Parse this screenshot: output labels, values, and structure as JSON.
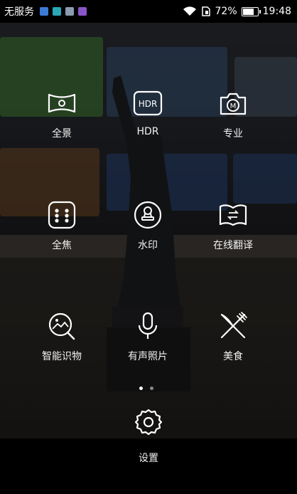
{
  "status_bar": {
    "carrier": "无服务",
    "battery_percent": "72%",
    "time": "19:48",
    "notification_icons": [
      "blue-app-icon",
      "teal-app-icon",
      "gallery-icon",
      "purple-app-icon"
    ]
  },
  "modes": [
    {
      "label": "全景",
      "icon": "panorama-icon"
    },
    {
      "label": "HDR",
      "icon": "hdr-icon",
      "icon_text": "HDR"
    },
    {
      "label": "专业",
      "icon": "pro-mode-icon",
      "icon_text": "M"
    },
    {
      "label": "全焦",
      "icon": "all-focus-icon"
    },
    {
      "label": "水印",
      "icon": "watermark-icon"
    },
    {
      "label": "在线翻译",
      "icon": "translate-icon"
    },
    {
      "label": "智能识物",
      "icon": "object-recognition-icon"
    },
    {
      "label": "有声照片",
      "icon": "microphone-icon"
    },
    {
      "label": "美食",
      "icon": "food-icon"
    }
  ],
  "pager": {
    "pages": 2,
    "current": 1
  },
  "settings": {
    "label": "设置",
    "icon": "gear-icon"
  },
  "colors": {
    "background": "#000000",
    "text": "#ffffff",
    "page_dot_inactive": "#888888"
  }
}
